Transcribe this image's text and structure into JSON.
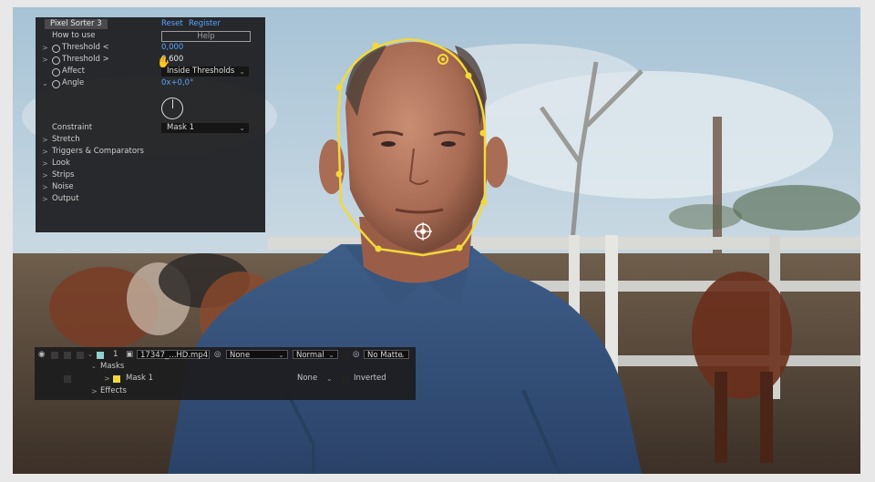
{
  "effect_panel": {
    "title": "Pixel Sorter 3",
    "reset_link": "Reset",
    "register_link": "Register",
    "how_to_use_label": "How to use",
    "help_button": "Help",
    "threshold_low_label": "Threshold <",
    "threshold_low_value": "0,000",
    "threshold_high_label": "Threshold >",
    "threshold_high_value": "0,600",
    "affect_label": "Affect",
    "affect_value": "Inside Thresholds",
    "angle_label": "Angle",
    "angle_value": "0x+0,0°",
    "constraint_label": "Constraint",
    "constraint_value": "Mask 1",
    "groups": [
      "Stretch",
      "Triggers & Comparators",
      "Look",
      "Strips",
      "Noise",
      "Output"
    ]
  },
  "timeline": {
    "layer_number": "1",
    "layer_name": "17347_...HD.mp4",
    "parent_value": "None",
    "blend_mode": "Normal",
    "track_matte": "No Matte",
    "masks_label": "Masks",
    "mask_name": "Mask 1",
    "mask_mode": "None",
    "inverted_label": "Inverted",
    "effects_label": "Effects"
  },
  "colors": {
    "mask_path": "#f2d93a",
    "link_blue": "#5aa3ff",
    "label_swatch": "#8fd2cf",
    "mask_swatch": "#f2d93a"
  }
}
